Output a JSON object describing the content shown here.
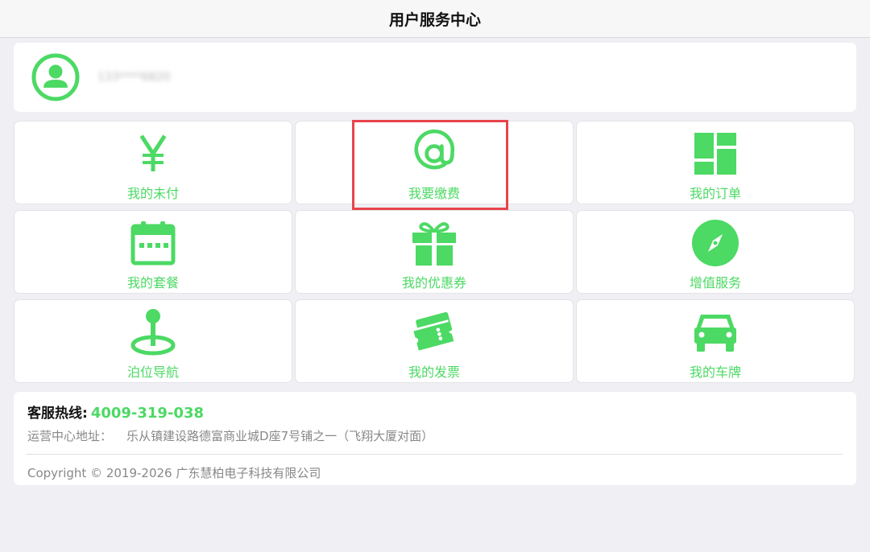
{
  "header": {
    "title": "用户服务中心"
  },
  "user": {
    "name": "133****6820",
    "avatar_icon": "user-avatar-icon"
  },
  "colors": {
    "accent": "#4cd964",
    "highlight": "#e8434b",
    "background": "#efeff4"
  },
  "grid": {
    "items": [
      {
        "label": "我的未付",
        "icon": "yuan-icon"
      },
      {
        "label": "我要缴费",
        "icon": "at-icon"
      },
      {
        "label": "我的订单",
        "icon": "dashboard-icon"
      },
      {
        "label": "我的套餐",
        "icon": "calendar-icon"
      },
      {
        "label": "我的优惠券",
        "icon": "gift-icon"
      },
      {
        "label": "增值服务",
        "icon": "compass-icon"
      },
      {
        "label": "泊位导航",
        "icon": "location-pin-icon"
      },
      {
        "label": "我的发票",
        "icon": "ticket-icon"
      },
      {
        "label": "我的车牌",
        "icon": "car-icon"
      }
    ]
  },
  "footer": {
    "hotline_label": "客服热线:",
    "hotline_number": "4009-319-038",
    "address_label": "运营中心地址：",
    "address_value": "乐从镇建设路德富商业城D座7号铺之一（飞翔大厦对面）",
    "copyright": "Copyright © 2019-2026 广东慧柏电子科技有限公司"
  }
}
